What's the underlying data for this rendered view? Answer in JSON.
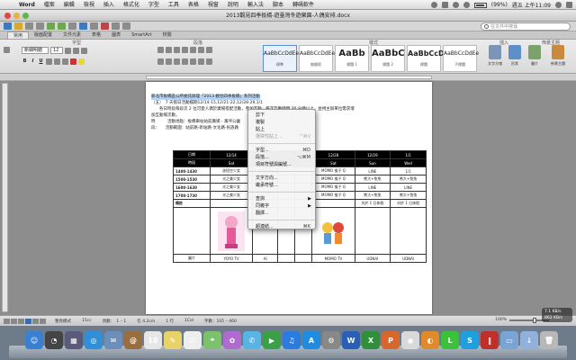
{
  "menubar": {
    "app": "Word",
    "items": [
      "檔案",
      "編輯",
      "檢視",
      "插入",
      "格式化",
      "字型",
      "工具",
      "表格",
      "視窗",
      "說明",
      "輸入法",
      "腳本",
      "轉碼軟件"
    ],
    "clock": "週五 上午11:09",
    "battery": "(99%)"
  },
  "window": {
    "title": "2013觀見四季板橋-遊臺灣冬遊樂園-人偶安排.docx"
  },
  "search": {
    "placeholder": "在文件中搜尋"
  },
  "ribbon": {
    "tabs": [
      "常用",
      "版面配置",
      "文件元素",
      "表格",
      "圖表",
      "SmartArt",
      "校閱"
    ],
    "groups": {
      "font": "字型",
      "paragraph": "段落",
      "styles": "樣式",
      "insert": "插入",
      "theme": "佈景主題"
    },
    "font_name": "新細明體",
    "font_size": "12",
    "styles": [
      {
        "preview": "AaBbCcDdEe",
        "name": "標準",
        "big": false
      },
      {
        "preview": "AaBbCcDdEe",
        "name": "無間距",
        "big": false
      },
      {
        "preview": "AaBb",
        "name": "標題 1",
        "big": true
      },
      {
        "preview": "AaBbC",
        "name": "標題 2",
        "big": true
      },
      {
        "preview": "AaBbCcD",
        "name": "標題",
        "big": true
      },
      {
        "preview": "AaBbCcDdEe",
        "name": "子標題",
        "big": false
      }
    ],
    "big_buttons": [
      "文字方塊",
      "形狀",
      "圖片",
      "佈景主題"
    ]
  },
  "document": {
    "lines": [
      "新北市板橋區公所委託辦理「2013 觀見四季板橋」系列活動",
      "（五）　7 天假日活動檔期12/14-15,12/21-22,12/28-29,1/1",
      "　　各日時段每段次 2 位可愛人偶於廣場搭配活動，參加互動，每次互動時間 30 分鐘以上，並視主辦單位需求增",
      "加互動場次數。",
      "時　　　活動地點：板橋車站站前廣場 - 萬坪公園",
      "段：　　活動範圍：站前路-新站路-文化路-民族路"
    ],
    "table": {
      "header_dates": [
        "日期",
        "12/14",
        "12/15",
        "12/21",
        "12/22",
        "12/28",
        "12/29",
        "1/1"
      ],
      "header_days": [
        "時段",
        "Sat",
        "Sun",
        "Sat",
        "Sun",
        "Sat",
        "Sun",
        "Wed"
      ],
      "rows": [
        {
          "slot": "1400-1430",
          "cells": [
            "孫悟空少女",
            "蠟筆小新",
            "",
            "",
            "MOMO 猴子 Q",
            "LINE",
            "1/1"
          ]
        },
        {
          "slot": "1500-1530",
          "cells": [
            "光之美少女",
            "小新-媽媽",
            "",
            "",
            "MOMO 猴子 Q",
            "熊大+兔兔",
            "熊大+兔兔"
          ]
        },
        {
          "slot": "1600-1630",
          "cells": [
            "光之美少女",
            "蠟筆小新",
            "",
            "",
            "MOMO 猴子 Q",
            "LINE",
            "LINE"
          ]
        },
        {
          "slot": "1700-1730",
          "cells": [
            "光之美少女",
            "小新-媽媽",
            "",
            "",
            "MOMO 猴子 Q",
            "熊大+兔兔",
            "熊大+兔兔"
          ]
        },
        {
          "slot": "備註",
          "cells": [
            "",
            "",
            "",
            "",
            "",
            "另於 1 日休假",
            "另於 1 日休假"
          ]
        }
      ],
      "footer": [
        "圖片",
        "YOYO TV",
        "AI",
        "",
        "",
        "MOMO TV",
        "UDNAI",
        "UDNAI"
      ]
    }
  },
  "context_menu": {
    "items": [
      {
        "label": "剪下",
        "shortcut": "",
        "disabled": false,
        "submenu": false
      },
      {
        "label": "複製",
        "shortcut": "",
        "disabled": false,
        "submenu": false
      },
      {
        "label": "貼上",
        "shortcut": "",
        "disabled": false,
        "submenu": false
      },
      {
        "label": "選擇性貼上...",
        "shortcut": "^⌘V",
        "disabled": true,
        "submenu": false
      },
      {
        "sep": true
      },
      {
        "label": "字型...",
        "shortcut": "⌘D",
        "disabled": false,
        "submenu": false
      },
      {
        "label": "段落...",
        "shortcut": "⌥⌘M",
        "disabled": false,
        "submenu": false
      },
      {
        "label": "項目符號與編號...",
        "shortcut": "",
        "disabled": false,
        "submenu": false
      },
      {
        "sep": true
      },
      {
        "label": "文字方向...",
        "shortcut": "",
        "disabled": false,
        "submenu": false
      },
      {
        "label": "繼承符號...",
        "shortcut": "",
        "disabled": false,
        "submenu": false
      },
      {
        "sep": true
      },
      {
        "label": "查詢",
        "shortcut": "",
        "disabled": false,
        "submenu": true
      },
      {
        "label": "同義字",
        "shortcut": "",
        "disabled": false,
        "submenu": true
      },
      {
        "label": "翻譯...",
        "shortcut": "",
        "disabled": false,
        "submenu": false
      },
      {
        "sep": true
      },
      {
        "label": "超連結...",
        "shortcut": "⌘K",
        "disabled": false,
        "submenu": false
      }
    ]
  },
  "statusbar": {
    "view_label": "整頁模式",
    "section": "15cc",
    "page": "頁數：　1 – 1",
    "position": "在 4.2cm",
    "line": "1 行",
    "col": "1Col",
    "words": "字數：105 – 460",
    "zoom": "100%"
  },
  "netmon": {
    "up": "7.1 KB/s",
    "down": "862 KB/s"
  },
  "dock": {
    "apps": [
      {
        "name": "finder-icon",
        "color": "#3b7fd0",
        "glyph": "☺"
      },
      {
        "name": "dashboard-icon",
        "color": "#444",
        "glyph": "◔"
      },
      {
        "name": "mission-control-icon",
        "color": "#5a5a7a",
        "glyph": "▦"
      },
      {
        "name": "safari-icon",
        "color": "#2f8fd8",
        "glyph": "◎"
      },
      {
        "name": "mail-icon",
        "color": "#6b8fb8",
        "glyph": "✉"
      },
      {
        "name": "contacts-icon",
        "color": "#9a6d3e",
        "glyph": "@"
      },
      {
        "name": "calendar-icon",
        "color": "#e6e6e6",
        "glyph": "18"
      },
      {
        "name": "notes-icon",
        "color": "#e8d36a",
        "glyph": "✎"
      },
      {
        "name": "reminders-icon",
        "color": "#eeeeee",
        "glyph": "☑"
      },
      {
        "name": "maps-icon",
        "color": "#7cc16c",
        "glyph": "⌖"
      },
      {
        "name": "photos-icon",
        "color": "#b06bd0",
        "glyph": "✿"
      },
      {
        "name": "messages-icon",
        "color": "#59b4e6",
        "glyph": "✆"
      },
      {
        "name": "facetime-icon",
        "color": "#3aa047",
        "glyph": "▶"
      },
      {
        "name": "itunes-icon",
        "color": "#2b7be0",
        "glyph": "♫"
      },
      {
        "name": "appstore-icon",
        "color": "#1f8ce0",
        "glyph": "A"
      },
      {
        "name": "preferences-icon",
        "color": "#888",
        "glyph": "⚙"
      },
      {
        "name": "word-icon",
        "color": "#2a5fb8",
        "glyph": "W"
      },
      {
        "name": "excel-icon",
        "color": "#2f8f3a",
        "glyph": "X"
      },
      {
        "name": "powerpoint-icon",
        "color": "#d7672c",
        "glyph": "P"
      },
      {
        "name": "chrome-icon",
        "color": "#d9d9d9",
        "glyph": "◉"
      },
      {
        "name": "firefox-icon",
        "color": "#e08a2c",
        "glyph": "◐"
      },
      {
        "name": "line-icon",
        "color": "#3cc13a",
        "glyph": "L"
      },
      {
        "name": "skype-icon",
        "color": "#1ea0e0",
        "glyph": "S"
      },
      {
        "name": "parallels-icon",
        "color": "#c0302a",
        "glyph": "‖"
      },
      {
        "name": "folder-icon",
        "color": "#7aa3d6",
        "glyph": "▭"
      },
      {
        "name": "downloads-icon",
        "color": "#8fb1db",
        "glyph": "↓"
      },
      {
        "name": "trash-icon",
        "color": "#b8b8b8",
        "glyph": "🗑"
      }
    ]
  }
}
